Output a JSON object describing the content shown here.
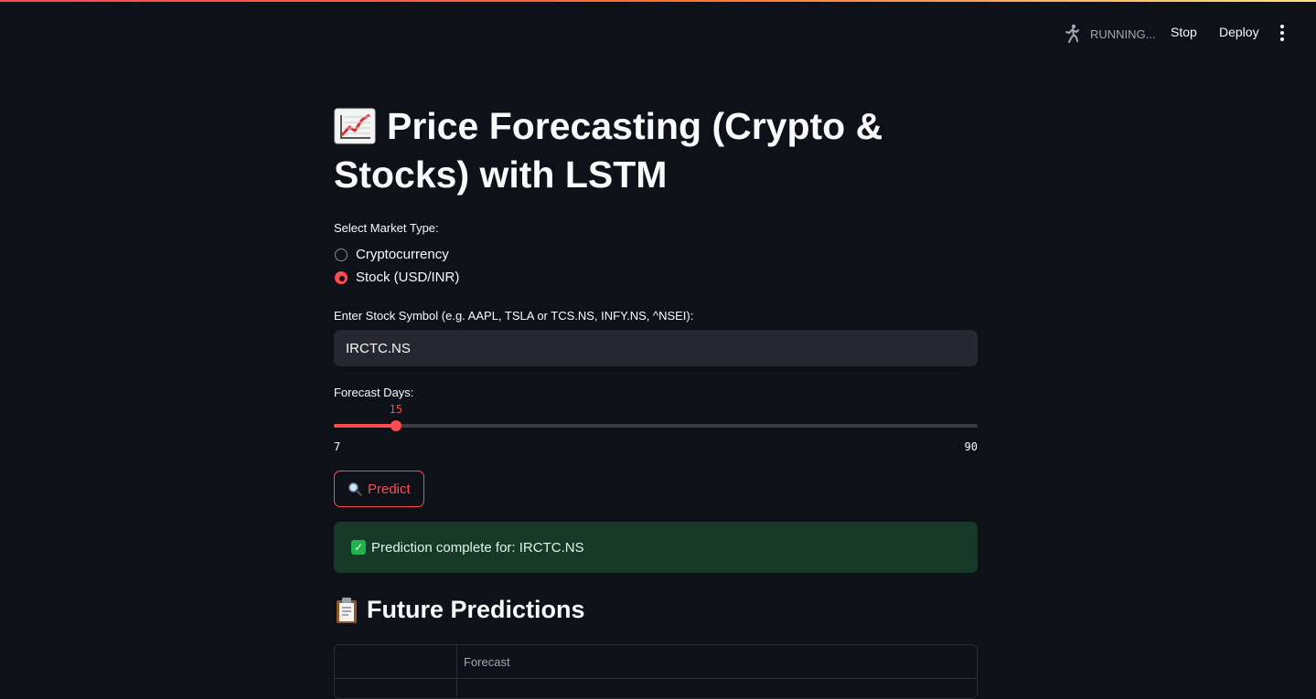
{
  "header": {
    "status_text": "RUNNING...",
    "stop_label": "Stop",
    "deploy_label": "Deploy",
    "menu_icon": "vertical-dots-icon",
    "running_icon": "running-man-icon",
    "accent_gradient": [
      "#ff4b4b",
      "#ff6c3a",
      "#ffe08a"
    ]
  },
  "main": {
    "title": "Price Forecasting (Crypto & Stocks) with LSTM",
    "title_icon": "chart-increasing-icon",
    "market_type": {
      "label": "Select Market Type:",
      "options": [
        "Cryptocurrency",
        "Stock (USD/INR)"
      ],
      "selected": "Stock (USD/INR)"
    },
    "symbol_input": {
      "label": "Enter Stock Symbol (e.g. AAPL, TSLA or TCS.NS, INFY.NS, ^NSEI):",
      "value": "IRCTC.NS"
    },
    "forecast_slider": {
      "label": "Forecast Days:",
      "min": 7,
      "max": 90,
      "value": 15,
      "min_label": "7",
      "max_label": "90",
      "value_label": "15"
    },
    "predict_button": {
      "label": "Predict",
      "icon": "magnifying-glass-icon"
    },
    "success": {
      "message": "Prediction complete for: IRCTC.NS",
      "icon": "check-mark-icon",
      "bg_color": "#173928"
    },
    "predictions": {
      "title": "Future Predictions",
      "icon": "clipboard-icon",
      "columns": [
        "",
        "Forecast"
      ]
    }
  },
  "colors": {
    "background": "#0e1117",
    "accent": "#ff4b4b",
    "input_bg": "#262730"
  }
}
